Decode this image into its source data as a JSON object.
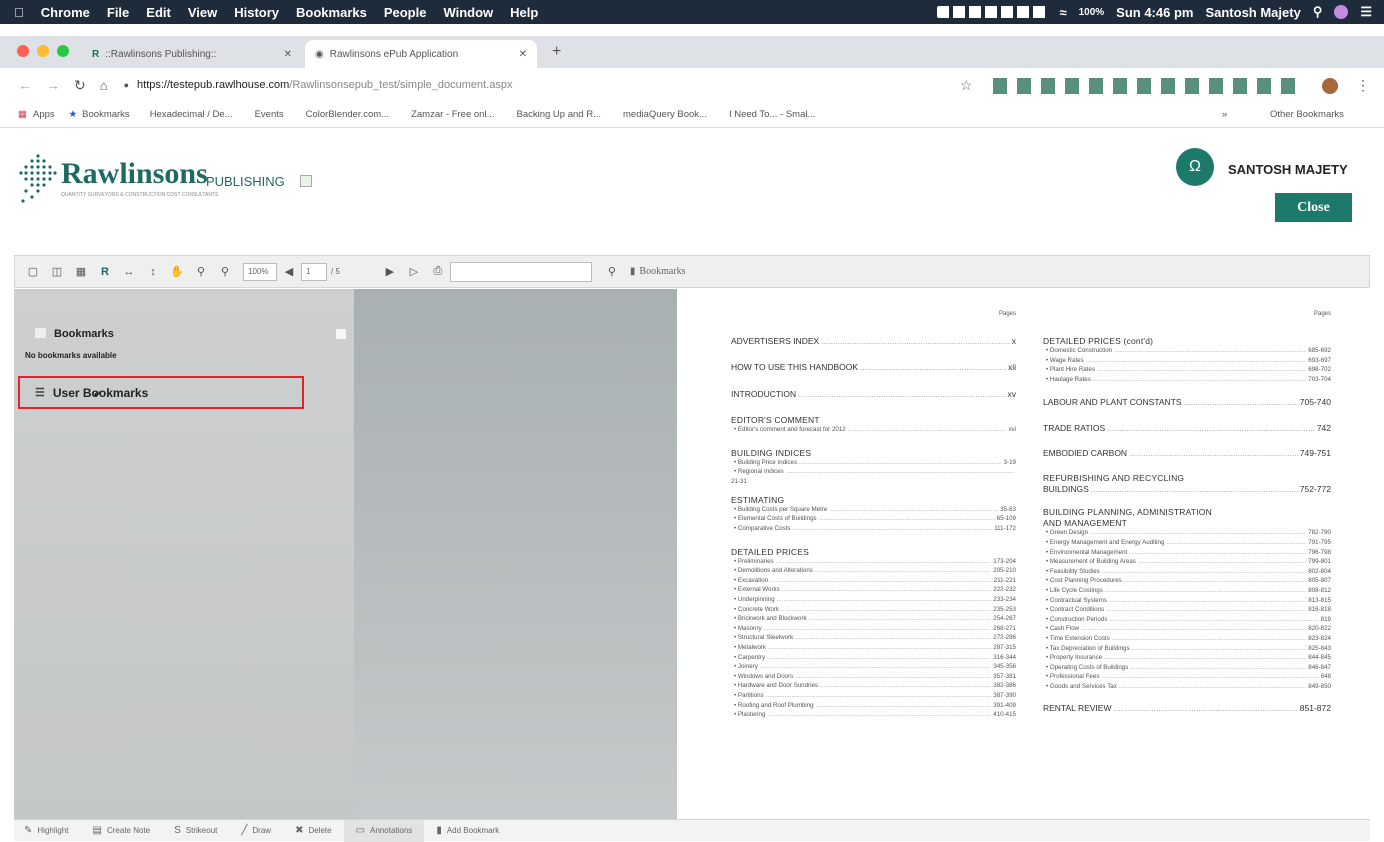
{
  "menubar": {
    "items": [
      "Chrome",
      "File",
      "Edit",
      "View",
      "History",
      "Bookmarks",
      "People",
      "Window",
      "Help"
    ],
    "battery": "100%",
    "clock": "Sun 4:46 pm",
    "user": "Santosh Majety"
  },
  "browser": {
    "tabs": [
      {
        "label": "::Rawlinsons Publishing::"
      },
      {
        "label": "Rawlinsons ePub Application"
      }
    ],
    "url_host": "https://testepub.rawlhouse.com",
    "url_path": "/Rawlinsonsepub_test/simple_document.aspx",
    "bookmarks": [
      "Apps",
      "Bookmarks",
      "Hexadecimal / De...",
      "Events",
      "ColorBlender.com...",
      "Zamzar - Free onl...",
      "Backing Up and R...",
      "mediaQuery Book...",
      "I Need To... - Smal..."
    ],
    "other_bookmarks": "Other Bookmarks"
  },
  "header": {
    "logo_name": "Rawlinsons",
    "logo_publishing": "PUBLISHING",
    "logo_tagline": "QUANTITY SURVEYORS & CONSTRUCTION COST CONSULTANTS",
    "avatar_glyph": "Ω",
    "user_name": "SANTOSH MAJETY",
    "close_label": "Close"
  },
  "viewer": {
    "zoom": "100%",
    "page": "1",
    "page_total": "/ 5",
    "search_value": "",
    "bookmarks_label": "Bookmarks"
  },
  "bookmarks_panel": {
    "title": "Bookmarks",
    "empty": "No bookmarks available",
    "user_bookmarks": "User Bookmarks"
  },
  "bottom_toolbar": [
    {
      "icon": "pencil-icon",
      "label": "Highlight"
    },
    {
      "icon": "note-icon",
      "label": "Create Note"
    },
    {
      "icon": "strikeout-icon",
      "label": "Strikeout"
    },
    {
      "icon": "draw-icon",
      "label": "Draw"
    },
    {
      "icon": "delete-icon",
      "label": "Delete"
    },
    {
      "icon": "annotations-icon",
      "label": "Annotations"
    },
    {
      "icon": "bookmark-icon",
      "label": "Add Bookmark"
    }
  ],
  "contents": {
    "pages_label": "Pages",
    "left": [
      {
        "t": "ADVERTISERS INDEX",
        "p": "x"
      },
      {
        "t": "HOW TO USE THIS HANDBOOK",
        "p": "xii"
      },
      {
        "t": "INTRODUCTION",
        "p": "xv"
      },
      {
        "t": "EDITOR'S COMMENT",
        "items": [
          [
            "Editor's comment and forecast for 2012",
            "xvi"
          ]
        ]
      },
      {
        "t": "BUILDING INDICES",
        "items": [
          [
            "Building Price Indices",
            "3-19"
          ],
          [
            "Regional Indices",
            ""
          ]
        ],
        "extra": "21-31"
      },
      {
        "t": "ESTIMATING",
        "items": [
          [
            "Building Costs per Square Metre",
            "35-63"
          ],
          [
            "Elemental Costs of Buildings",
            "65-109"
          ],
          [
            "Comparative Costs",
            "111-172"
          ]
        ]
      },
      {
        "t": "DETAILED PRICES",
        "items": [
          [
            "Preliminaries",
            "173-204"
          ],
          [
            "Demolitions and Alterations",
            "205-210"
          ],
          [
            "Excavation",
            "211-221"
          ],
          [
            "External Works",
            "222-232"
          ],
          [
            "Underpinning",
            "233-234"
          ],
          [
            "Concrete Work",
            "235-253"
          ],
          [
            "Brickwork and Blockwork",
            "254-267"
          ],
          [
            "Masonry",
            "268-271"
          ],
          [
            "Structural Steelwork",
            "272-286"
          ],
          [
            "Metalwork",
            "287-315"
          ],
          [
            "Carpentry",
            "316-344"
          ],
          [
            "Joinery",
            "345-356"
          ],
          [
            "Windows and Doors",
            "357-381"
          ],
          [
            "Hardware and Door Sundries",
            "382-386"
          ],
          [
            "Partitions",
            "387-390"
          ],
          [
            "Roofing and Roof Plumbing",
            "391-409"
          ],
          [
            "Plastering",
            "410-415"
          ]
        ]
      }
    ],
    "right": [
      {
        "t": "DETAILED PRICES (cont'd)",
        "items": [
          [
            "Domestic Construction",
            "685-692"
          ],
          [
            "Wage Rates",
            "693-697"
          ],
          [
            "Plant Hire Rates",
            "698-702"
          ],
          [
            "Haulage Rates",
            "703-704"
          ]
        ]
      },
      {
        "t": "LABOUR AND PLANT CONSTANTS",
        "p": "705-740"
      },
      {
        "t": "TRADE RATIOS",
        "p": "742"
      },
      {
        "t": "EMBODIED CARBON",
        "p": "749-751"
      },
      {
        "t": "REFURBISHING AND RECYCLING",
        "t2": "BUILDINGS",
        "p": "752-772"
      },
      {
        "t": "BUILDING PLANNING, ADMINISTRATION",
        "t2": "AND MANAGEMENT",
        "items": [
          [
            "Green Design",
            "782-790"
          ],
          [
            "Energy Management and Energy Auditing",
            "791-795"
          ],
          [
            "Environmental Management",
            "796-798"
          ],
          [
            "Measurement of Building Areas",
            "799-801"
          ],
          [
            "Feasibility Studies",
            "802-804"
          ],
          [
            "Cost Planning Procedures",
            "805-807"
          ],
          [
            "Life Cycle Costings",
            "808-812"
          ],
          [
            "Contractual Systems",
            "813-815"
          ],
          [
            "Contract Conditions",
            "816-818"
          ],
          [
            "Construction Periods",
            "819"
          ],
          [
            "Cash Flow",
            "820-822"
          ],
          [
            "Time Extension Costs",
            "823-824"
          ],
          [
            "Tax Depreciation of Buildings",
            "825-843"
          ],
          [
            "Property Insurance",
            "844-845"
          ],
          [
            "Operating Costs of Buildings",
            "846-847"
          ],
          [
            "Professional Fees",
            "848"
          ],
          [
            "Goods and Services Tax",
            "849-850"
          ]
        ]
      },
      {
        "t": "RENTAL REVIEW",
        "p": "851-872"
      }
    ]
  }
}
